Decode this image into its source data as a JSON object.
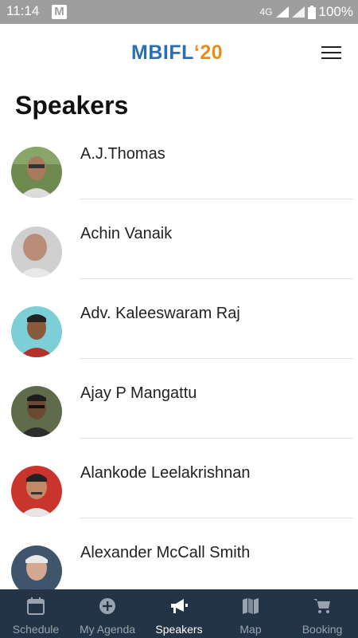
{
  "status_bar": {
    "time": "11:14",
    "notification_icon": "M",
    "network": "4G",
    "battery": "100%"
  },
  "header": {
    "logo_text": "MBIFL",
    "logo_year": "‘20",
    "menu_icon": "hamburger-menu-icon"
  },
  "page": {
    "title": "Speakers"
  },
  "speakers": [
    {
      "name": "A.J.Thomas"
    },
    {
      "name": "Achin Vanaik"
    },
    {
      "name": "Adv. Kaleeswaram Raj"
    },
    {
      "name": "Ajay P Mangattu"
    },
    {
      "name": "Alankode Leelakrishnan"
    },
    {
      "name": "Alexander McCall Smith"
    }
  ],
  "bottom_nav": {
    "items": [
      {
        "label": "Schedule",
        "icon": "calendar-icon"
      },
      {
        "label": "My Agenda",
        "icon": "plus-circle-icon"
      },
      {
        "label": "Speakers",
        "icon": "megaphone-icon"
      },
      {
        "label": "Map",
        "icon": "map-icon"
      },
      {
        "label": "Booking",
        "icon": "cart-icon"
      }
    ],
    "active": "Speakers"
  },
  "colors": {
    "nav_background": "#243447",
    "status_bar": "#9e9e9e",
    "logo_primary": "#2a6fb6",
    "logo_accent": "#e98d1c"
  }
}
